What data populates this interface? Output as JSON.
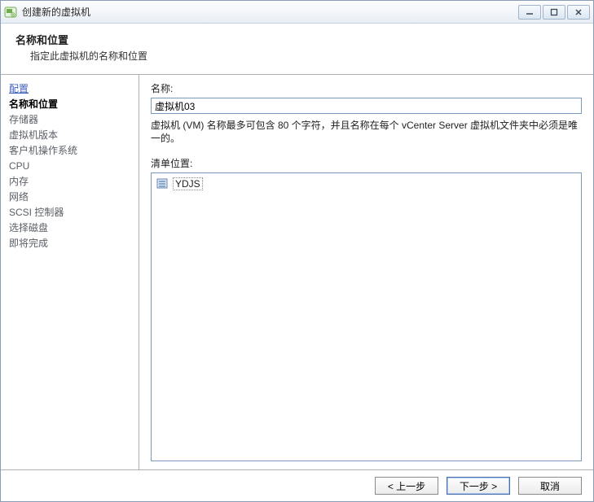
{
  "window": {
    "title": "创建新的虚拟机"
  },
  "header": {
    "title": "名称和位置",
    "subtitle": "指定此虚拟机的名称和位置"
  },
  "sidebar": {
    "items": [
      {
        "label": "配置",
        "state": "link"
      },
      {
        "label": "名称和位置",
        "state": "current"
      },
      {
        "label": "存储器",
        "state": "pending"
      },
      {
        "label": "虚拟机版本",
        "state": "pending"
      },
      {
        "label": "客户机操作系统",
        "state": "pending"
      },
      {
        "label": "CPU",
        "state": "pending"
      },
      {
        "label": "内存",
        "state": "pending"
      },
      {
        "label": "网络",
        "state": "pending"
      },
      {
        "label": "SCSI 控制器",
        "state": "pending"
      },
      {
        "label": "选择磁盘",
        "state": "pending"
      },
      {
        "label": "即将完成",
        "state": "pending"
      }
    ]
  },
  "main": {
    "name_label": "名称:",
    "name_value": "虚拟机03",
    "help_text": "虚拟机 (VM) 名称最多可包含 80 个字符，并且名称在每个 vCenter Server 虚拟机文件夹中必须是唯一的。",
    "inventory_label": "清单位置:",
    "tree": [
      {
        "label": "YDJS",
        "selected": true
      }
    ]
  },
  "footer": {
    "back": "< 上一步",
    "next": "下一步 >",
    "cancel": "取消"
  }
}
